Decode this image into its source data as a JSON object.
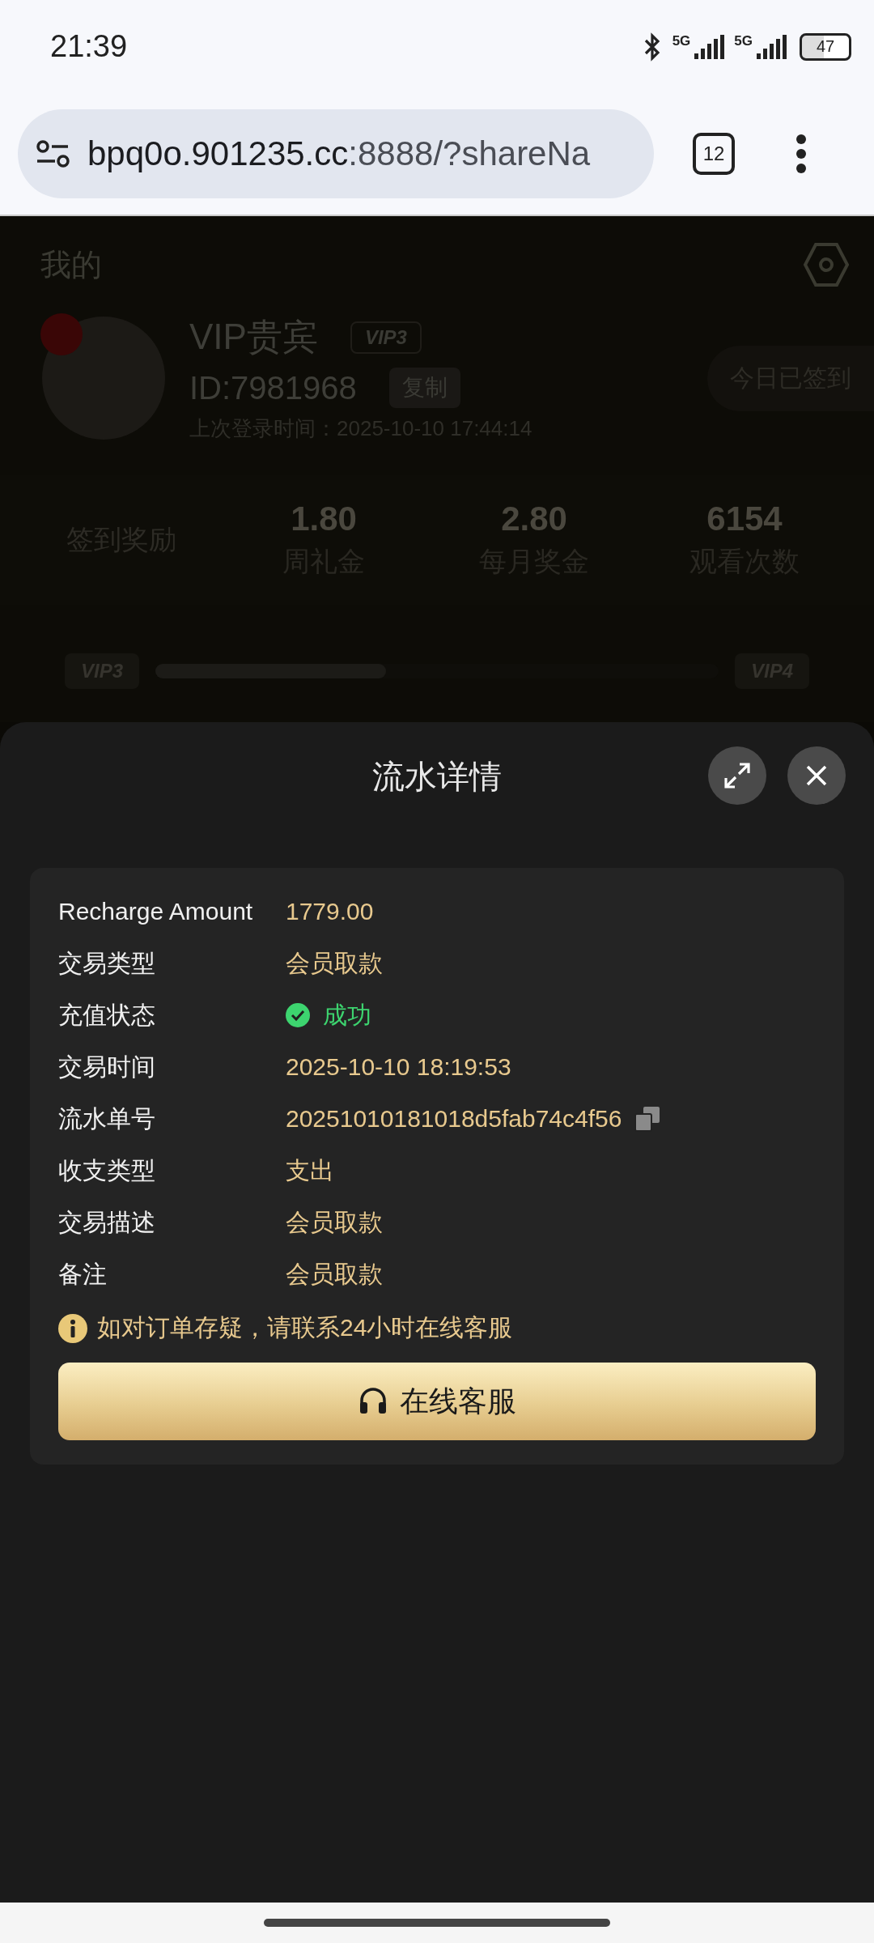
{
  "status_bar": {
    "time": "21:39",
    "network_1": "5G",
    "network_2": "5G",
    "battery": "47"
  },
  "browser": {
    "url_host": "bpq0o.901235.cc",
    "url_rest": ":8888/?shareNa",
    "tab_count": "12"
  },
  "page": {
    "title": "我的",
    "profile": {
      "name": "VIP贵宾",
      "vip_badge": "VIP3",
      "id": "ID:7981968",
      "copy_button": "复制",
      "last_login": "上次登录时间：2025-10-10 17:44:14",
      "checkin_button": "今日已签到"
    },
    "stats": {
      "label": "签到奖励",
      "items": [
        {
          "value": "1.80",
          "label": "周礼金"
        },
        {
          "value": "2.80",
          "label": "每月奖金"
        },
        {
          "value": "6154",
          "label": "观看次数"
        }
      ]
    },
    "vip_progress": {
      "from": "VIP3",
      "to": "VIP4",
      "level": 0.41
    }
  },
  "sheet": {
    "title": "流水详情",
    "rows": [
      {
        "kind": "text",
        "label": "Recharge Amount",
        "value": "1779.00"
      },
      {
        "kind": "text",
        "label": "交易类型",
        "value": "会员取款"
      },
      {
        "kind": "status",
        "label": "充值状态",
        "value": "成功",
        "success": true
      },
      {
        "kind": "text",
        "label": "交易时间",
        "value": "2025-10-10 18:19:53"
      },
      {
        "kind": "copyable",
        "label": "流水单号",
        "value": "20251010181018d5fab74c4f56"
      },
      {
        "kind": "text",
        "label": "收支类型",
        "value": "支出"
      },
      {
        "kind": "text",
        "label": "交易描述",
        "value": "会员取款"
      },
      {
        "kind": "text",
        "label": "备注",
        "value": "会员取款"
      }
    ],
    "notice": "如对订单存疑，请联系24小时在线客服",
    "support_button": "在线客服"
  }
}
